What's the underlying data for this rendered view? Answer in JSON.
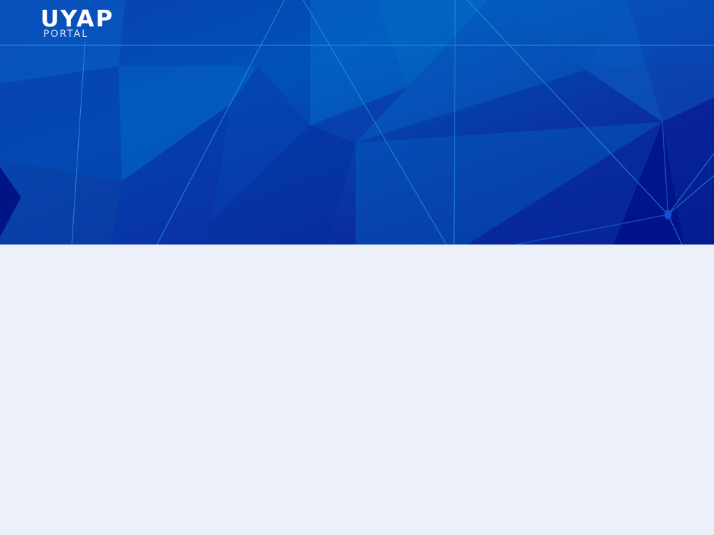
{
  "header": {
    "logo": {
      "title": "UYAP",
      "subtitle": "PORTAL"
    }
  },
  "colors": {
    "hero_primary": "#0052b8",
    "hero_dark": "#001a8a",
    "hero_line": "#2fa4e0",
    "page_background": "#ecf0f8"
  }
}
